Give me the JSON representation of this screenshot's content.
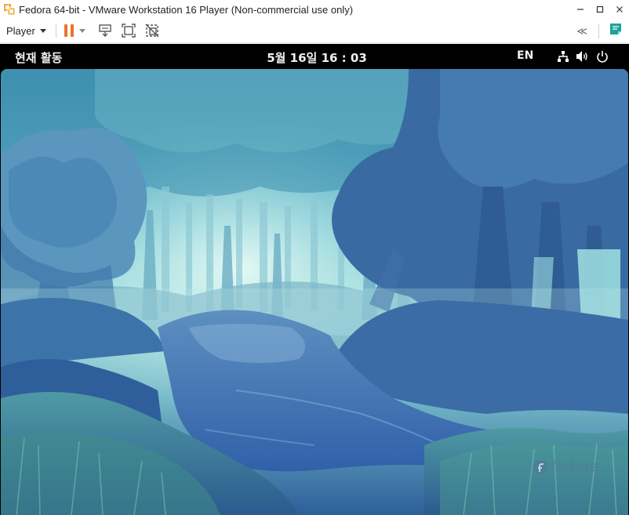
{
  "window": {
    "title": "Fedora 64-bit - VMware Workstation 16 Player (Non-commercial use only)",
    "app_icon": "vmware-player-icon",
    "controls": [
      "minimize-icon",
      "maximize-icon",
      "close-icon"
    ]
  },
  "toolbar": {
    "player_label": "Player",
    "pause_color": "#e8732c",
    "icons": [
      "pause-icon",
      "send-ctrl-alt-del-icon",
      "full-screen-icon",
      "unity-icon"
    ],
    "right_icons": [
      "collapse-chevron-icon",
      "notes-icon"
    ],
    "collapse_label": "≪"
  },
  "guest": {
    "activities_label": "현재 활동",
    "clock": "5월 16일  16 : 03",
    "input_language": "EN",
    "status_icons": [
      "network-icon",
      "volume-icon",
      "power-icon"
    ],
    "wallpaper": "fedora-forest-river-wallpaper",
    "watermark_text": "fedora"
  },
  "colors": {
    "topbar_bg": "#000000",
    "wallpaper_sky": "#9bd8e0",
    "wallpaper_trees": "#3f78a8",
    "wallpaper_water": "#2f5fa8",
    "notes_icon": "#1aa39a"
  }
}
